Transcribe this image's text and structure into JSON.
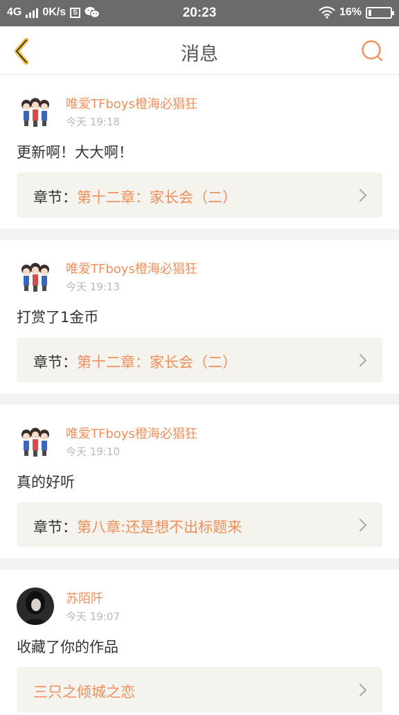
{
  "status_bar": {
    "network": "4G",
    "speed": "0K/s",
    "s_badge": "S",
    "time": "20:23",
    "battery": "16%"
  },
  "header": {
    "title": "消息"
  },
  "messages": [
    {
      "name": "唯爱TFboys橙海必猖狂",
      "time": "今天 19:18",
      "text": "更新啊！大大啊！",
      "ref_prefix": "章节：",
      "ref_link": "第十二章：家长会（二）"
    },
    {
      "name": "唯爱TFboys橙海必猖狂",
      "time": "今天 19:13",
      "text": "打赏了1金币",
      "ref_prefix": "章节：",
      "ref_link": "第十二章：家长会（二）"
    },
    {
      "name": "唯爱TFboys橙海必猖狂",
      "time": "今天 19:10",
      "text": "真的好听",
      "ref_prefix": "章节：",
      "ref_link": "第八章:还是想不出标题来"
    },
    {
      "name": "苏陌阡",
      "time": "今天 19:07",
      "text": "收藏了你的作品",
      "ref_prefix": "",
      "ref_link": "三只之倾城之恋"
    }
  ],
  "colors": {
    "accent": "#ef8f5b",
    "back_icon": "#f0c04a",
    "status_bar": "#6b6b6b",
    "ref_bg": "#f4f3ee"
  }
}
